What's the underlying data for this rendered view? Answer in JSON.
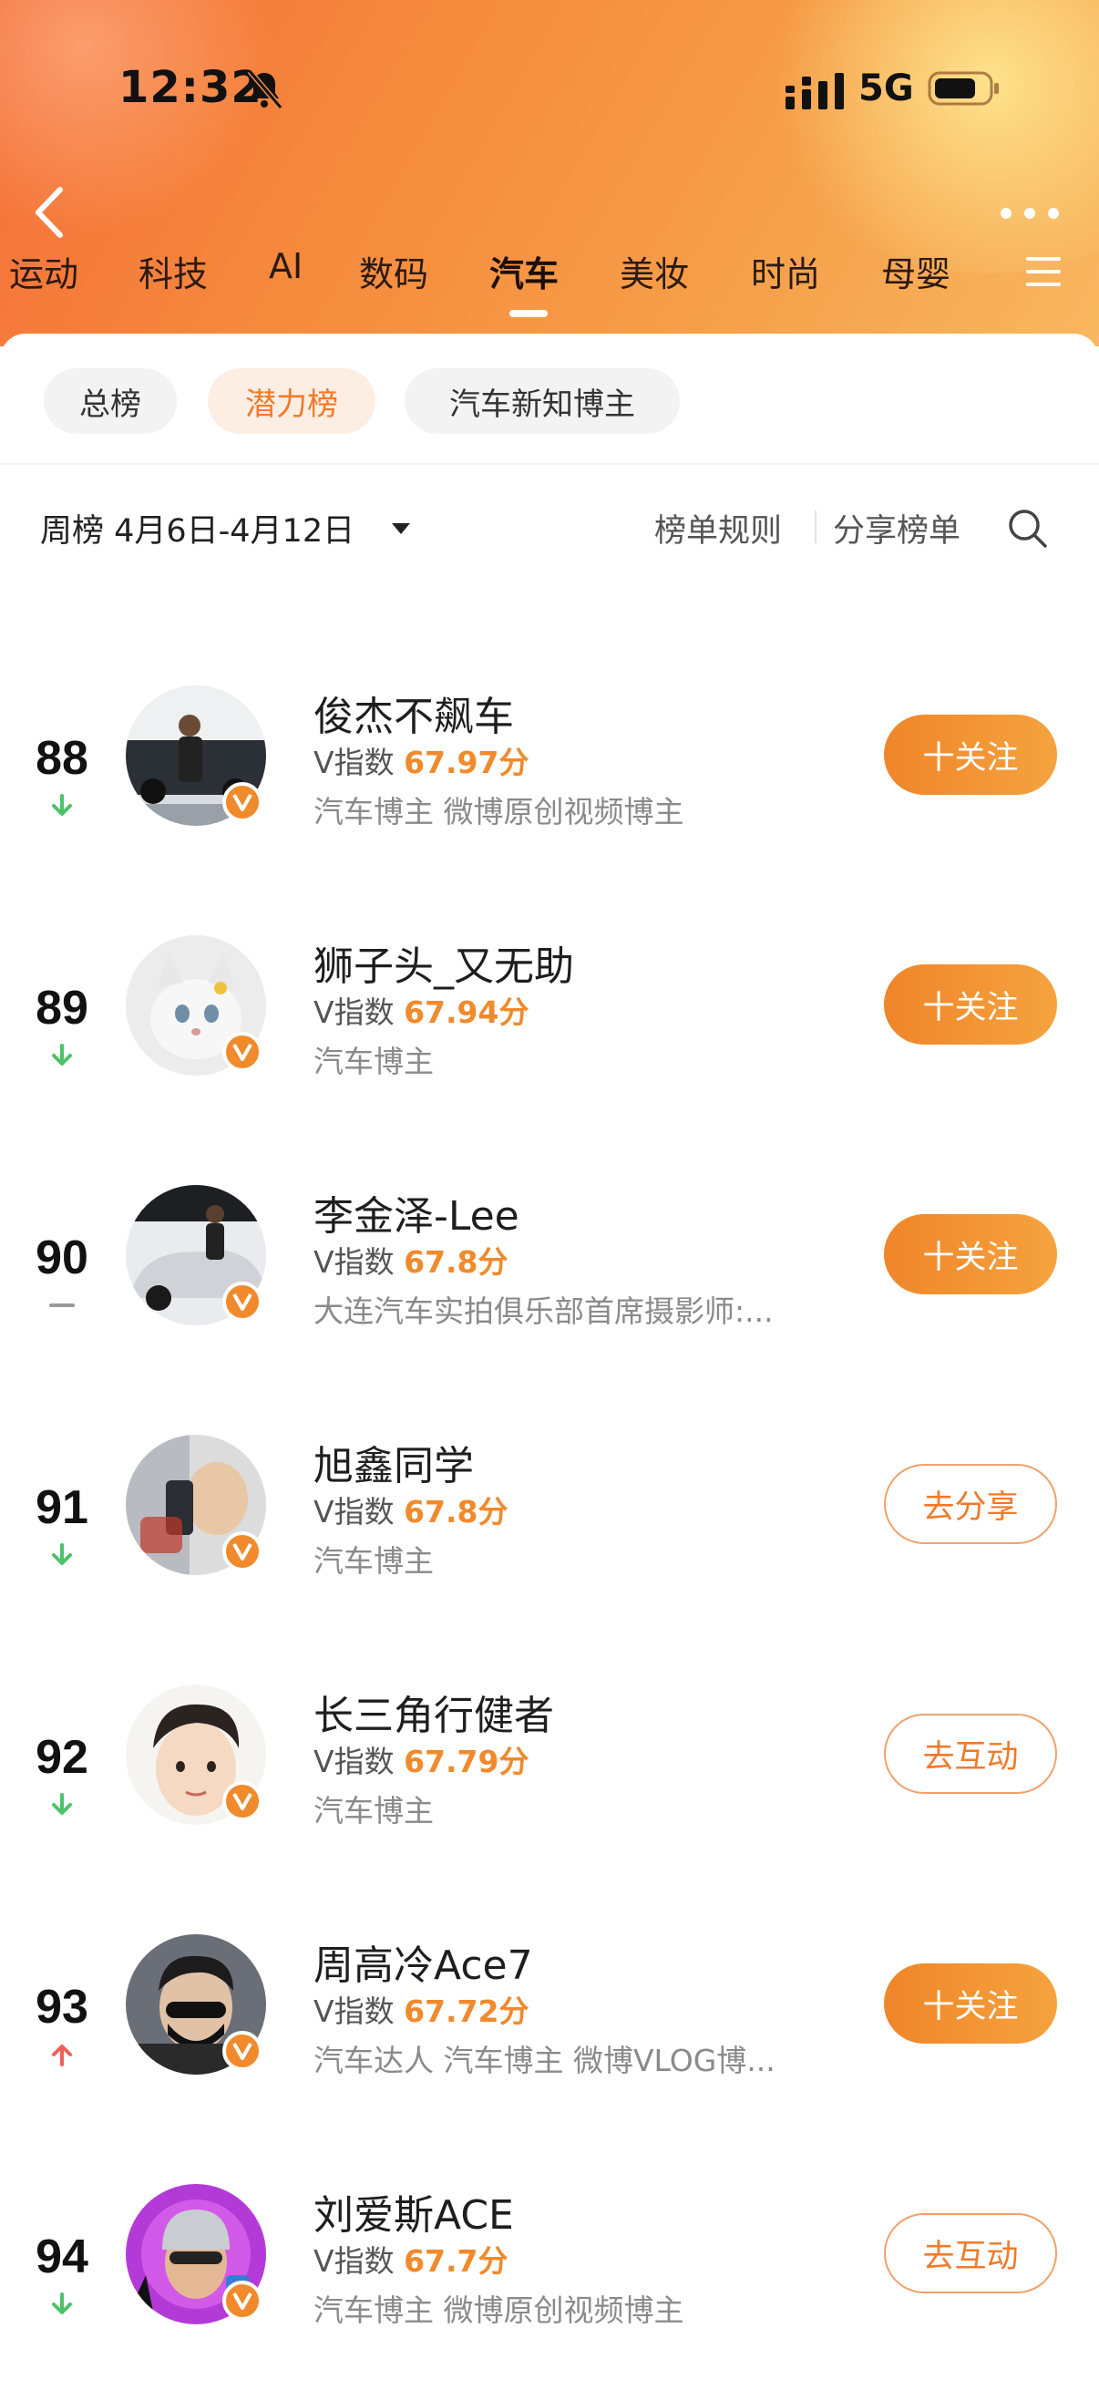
{
  "status_bar": {
    "time": "12:32",
    "network": "5G"
  },
  "tabs": [
    {
      "label": "运动"
    },
    {
      "label": "科技"
    },
    {
      "label": "AI"
    },
    {
      "label": "数码"
    },
    {
      "label": "汽车",
      "active": true
    },
    {
      "label": "美妆"
    },
    {
      "label": "时尚"
    },
    {
      "label": "母婴"
    }
  ],
  "chips": [
    {
      "label": "总榜"
    },
    {
      "label": "潜力榜",
      "active": true
    },
    {
      "label": "汽车新知博主"
    }
  ],
  "filter": {
    "period": "周榜 4月6日-4月12日",
    "rules": "榜单规则",
    "share": "分享榜单"
  },
  "colors": {
    "accent": "#f08a2c",
    "up": "#f0605a",
    "down": "#4cc36a",
    "flat": "#999999"
  },
  "rows": [
    {
      "rank": "88",
      "trend": "down",
      "name": "俊杰不飙车",
      "score_label": "V指数",
      "score": "67.97分",
      "desc": "汽车博主 微博原创视频博主",
      "action": "十关注",
      "action_type": "follow"
    },
    {
      "rank": "89",
      "trend": "down",
      "name": "狮子头_又无助",
      "score_label": "V指数",
      "score": "67.94分",
      "desc": "汽车博主",
      "action": "十关注",
      "action_type": "follow"
    },
    {
      "rank": "90",
      "trend": "flat",
      "name": "李金泽-Lee",
      "score_label": "V指数",
      "score": "67.8分",
      "desc": "大连汽车实拍俱乐部首席摄影师:...",
      "action": "十关注",
      "action_type": "follow"
    },
    {
      "rank": "91",
      "trend": "down",
      "name": "旭鑫同学",
      "score_label": "V指数",
      "score": "67.8分",
      "desc": "汽车博主",
      "action": "去分享",
      "action_type": "outline"
    },
    {
      "rank": "92",
      "trend": "down",
      "name": "长三角行健者",
      "score_label": "V指数",
      "score": "67.79分",
      "desc": "汽车博主",
      "action": "去互动",
      "action_type": "outline"
    },
    {
      "rank": "93",
      "trend": "up",
      "name": "周高冷Ace7",
      "score_label": "V指数",
      "score": "67.72分",
      "desc": "汽车达人 汽车博主 微博VLOG博...",
      "action": "十关注",
      "action_type": "follow"
    },
    {
      "rank": "94",
      "trend": "down",
      "name": "刘爱斯ACE",
      "score_label": "V指数",
      "score": "67.7分",
      "desc": "汽车博主 微博原创视频博主",
      "action": "去互动",
      "action_type": "outline"
    }
  ]
}
